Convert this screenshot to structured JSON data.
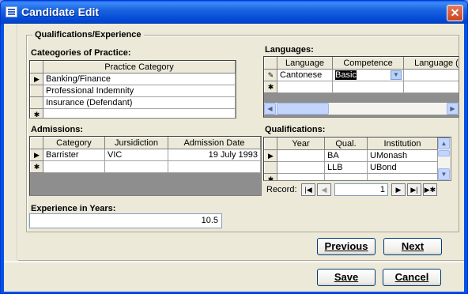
{
  "window": {
    "title": "Candidate Edit",
    "close_glyph": "✕"
  },
  "group": {
    "title": "Qualifications/Experience"
  },
  "practice": {
    "label": "Cateogories of Practice:",
    "header": "Practice Category",
    "rows": [
      "Banking/Finance",
      "Professional Indemnity",
      "Insurance (Defendant)",
      ""
    ]
  },
  "languages": {
    "label": "Languages:",
    "headers": [
      "Language",
      "Competence",
      "Language ("
    ],
    "row": {
      "language": "Cantonese",
      "competence": "Basic"
    }
  },
  "admissions": {
    "label": "Admissions:",
    "headers": [
      "Category",
      "Jursidiction",
      "Admission Date"
    ],
    "row": {
      "category": "Barrister",
      "jurisdiction": "VIC",
      "date": "19 July 1993"
    }
  },
  "qualifications": {
    "label": "Qualifications:",
    "headers": [
      "Year",
      "Qual.",
      "Institution"
    ],
    "rows": [
      {
        "year": "",
        "qual": "BA",
        "institution": "UMonash"
      },
      {
        "year": "",
        "qual": "LLB",
        "institution": "UBond"
      }
    ],
    "record_label": "Record:",
    "record_value": "1"
  },
  "experience": {
    "label": "Experience in Years:",
    "value": "10.5"
  },
  "buttons": {
    "previous": "Previous",
    "next": "Next",
    "save": "Save",
    "cancel": "Cancel"
  },
  "icons": {
    "current_row": "▶",
    "new_row": "✱",
    "edit_row": "pencil-icon",
    "dropdown": "▼"
  }
}
